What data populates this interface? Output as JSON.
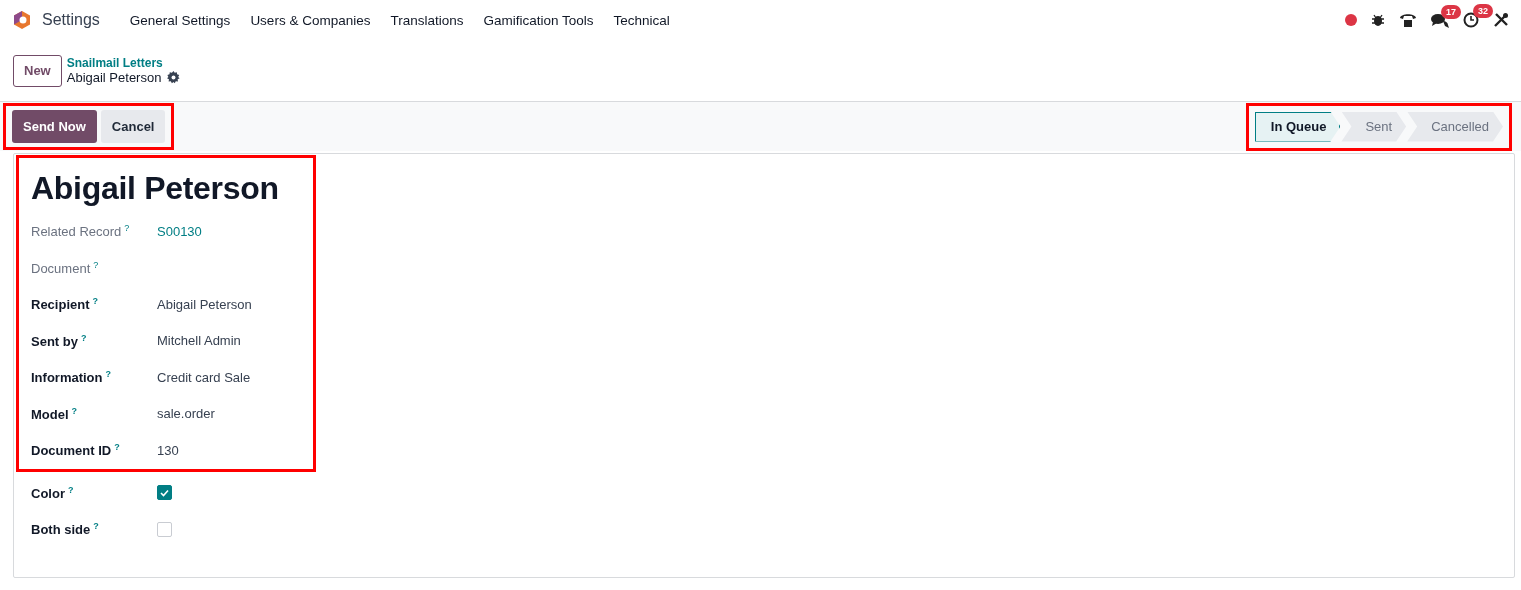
{
  "navbar": {
    "app_name": "Settings",
    "menu": [
      "General Settings",
      "Users & Companies",
      "Translations",
      "Gamification Tools",
      "Technical"
    ],
    "systray": [
      {
        "kind": "record"
      },
      {
        "kind": "debug"
      },
      {
        "kind": "phone"
      },
      {
        "kind": "chat",
        "badge": "17"
      },
      {
        "kind": "clock",
        "badge": "32"
      },
      {
        "kind": "tools"
      }
    ]
  },
  "control_panel": {
    "new_button": "New",
    "breadcrumb": "Snailmail Letters",
    "record_name": "Abigail Peterson"
  },
  "action_bar": {
    "highlighted": true,
    "buttons": [
      {
        "label": "Send Now",
        "primary": true
      },
      {
        "label": "Cancel",
        "primary": false
      }
    ]
  },
  "status_bar": {
    "highlighted": true,
    "stages": [
      {
        "label": "In Queue",
        "selected": true
      },
      {
        "label": "Sent",
        "selected": false
      },
      {
        "label": "Cancelled",
        "selected": false
      }
    ]
  },
  "form": {
    "groups": [
      {
        "highlighted": true,
        "title": "Abigail Peterson",
        "fields": [
          {
            "label": "Related Record",
            "help": "?",
            "readonly": true,
            "kind": "link",
            "value": "S00130"
          },
          {
            "label": "Document",
            "help": "?",
            "readonly": true,
            "kind": "text"
          },
          {
            "label": "Recipient",
            "help": "?",
            "readonly": false,
            "kind": "text",
            "value": "Abigail Peterson"
          },
          {
            "label": "Sent by",
            "help": "?",
            "readonly": false,
            "kind": "text",
            "value": "Mitchell Admin"
          },
          {
            "label": "Information",
            "help": "?",
            "readonly": false,
            "kind": "text",
            "value": "Credit card Sale"
          },
          {
            "label": "Model",
            "help": "?",
            "readonly": false,
            "kind": "text",
            "value": "sale.order"
          },
          {
            "label": "Document ID",
            "help": "?",
            "readonly": false,
            "kind": "text",
            "value": "130"
          }
        ]
      },
      {
        "fields": [
          {
            "label": "Color",
            "help": "?",
            "readonly": false,
            "kind": "checkbox",
            "checked": true
          },
          {
            "label": "Both side",
            "help": "?",
            "readonly": false,
            "kind": "checkbox",
            "checked": false
          }
        ]
      }
    ]
  }
}
